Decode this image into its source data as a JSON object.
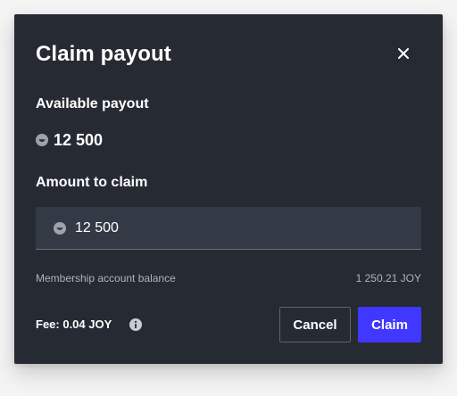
{
  "modal": {
    "title": "Claim payout",
    "close_icon": "close-icon"
  },
  "available": {
    "label": "Available payout",
    "icon": "joy-token-icon",
    "value": "12 500"
  },
  "amount": {
    "label": "Amount to claim",
    "icon": "joy-token-icon",
    "input_value": "12 500"
  },
  "balance": {
    "label": "Membership account balance",
    "value": "1 250.21 JOY"
  },
  "footer": {
    "fee": "Fee: 0.04 JOY",
    "info_icon": "info-icon",
    "cancel_label": "Cancel",
    "claim_label": "Claim"
  },
  "colors": {
    "modal_bg": "#262a33",
    "input_bg": "#343a45",
    "primary": "#4038ff",
    "muted_text": "#aeb2bb"
  }
}
